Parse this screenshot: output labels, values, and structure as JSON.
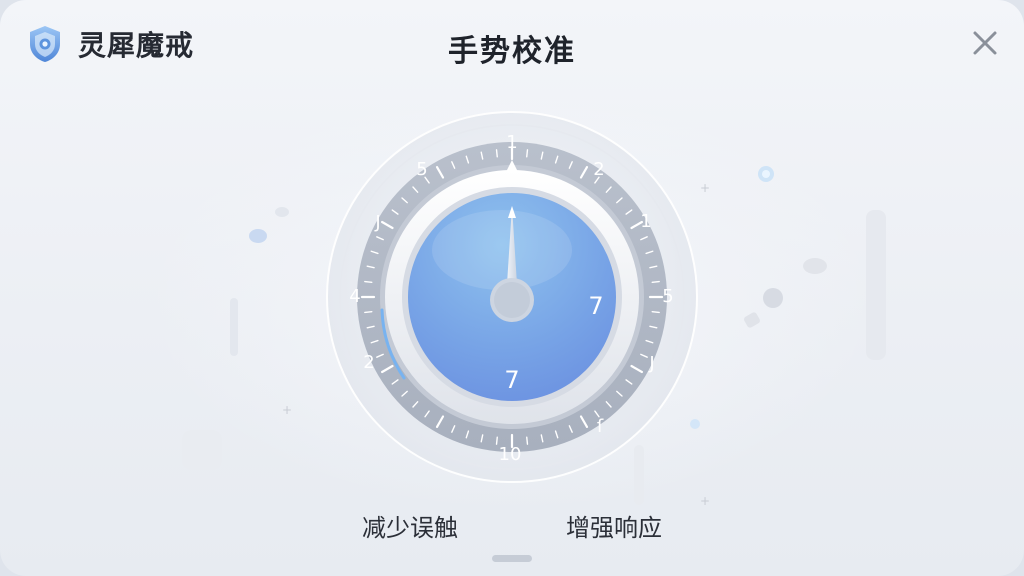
{
  "app": {
    "name": "灵犀魔戒"
  },
  "header": {
    "title": "手势校准"
  },
  "dial": {
    "ring_numbers": [
      "1",
      "2",
      "1",
      "5",
      "J",
      "ſ",
      "10",
      "2",
      "4",
      "J",
      "5"
    ],
    "inner_numbers": [
      "7",
      "7"
    ]
  },
  "options": {
    "left_label": "减少误触",
    "right_label": "增强响应"
  },
  "icons": {
    "brand": "shield-icon",
    "close": "close-icon"
  },
  "colors": {
    "accent": "#6b9de6",
    "dial_face": "#7aa4e6",
    "text": "#262a33"
  }
}
